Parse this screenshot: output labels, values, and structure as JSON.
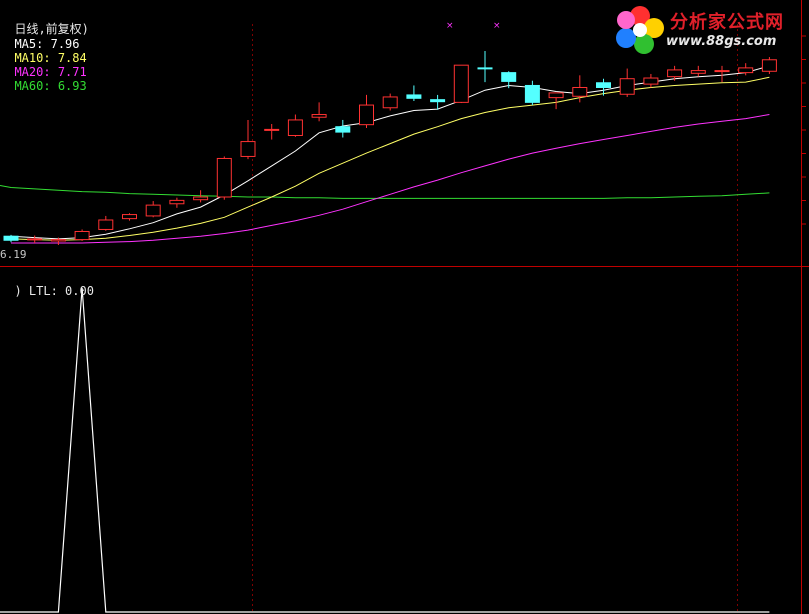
{
  "header": {
    "period": "日线,前复权)",
    "ma": [
      {
        "label": "MA5:",
        "value": "7.96",
        "color": "#ffffff"
      },
      {
        "label": "MA10:",
        "value": "7.84",
        "color": "#ffff66"
      },
      {
        "label": "MA20:",
        "value": "7.71",
        "color": "#ff33ff"
      },
      {
        "label": "MA60:",
        "value": "6.93",
        "color": "#33dd33"
      }
    ]
  },
  "low_label": "6.19",
  "indicator": {
    "label": ") LTL:",
    "value": "0.00"
  },
  "logo": {
    "name": "分析家公式网",
    "url": "www.88gs.com"
  },
  "colors": {
    "up": "#ff3232",
    "down": "#54ffff",
    "ma5": "#ffffff",
    "ma10": "#ffff66",
    "ma20": "#ff33ff",
    "ma60": "#33dd33",
    "divider": "#c00000",
    "ltl": "#ffffff"
  },
  "chart_data": [
    {
      "type": "candlestick",
      "title": "",
      "candles": [
        {
          "o": 6.32,
          "h": 6.34,
          "l": 6.23,
          "c": 6.26
        },
        {
          "o": 6.28,
          "h": 6.33,
          "l": 6.22,
          "c": 6.28
        },
        {
          "o": 6.25,
          "h": 6.3,
          "l": 6.19,
          "c": 6.27
        },
        {
          "o": 6.27,
          "h": 6.42,
          "l": 6.25,
          "c": 6.39
        },
        {
          "o": 6.42,
          "h": 6.62,
          "l": 6.4,
          "c": 6.56
        },
        {
          "o": 6.58,
          "h": 6.66,
          "l": 6.55,
          "c": 6.64
        },
        {
          "o": 6.62,
          "h": 6.84,
          "l": 6.6,
          "c": 6.78
        },
        {
          "o": 6.8,
          "h": 6.89,
          "l": 6.74,
          "c": 6.85
        },
        {
          "o": 6.86,
          "h": 7.0,
          "l": 6.82,
          "c": 6.9
        },
        {
          "o": 6.9,
          "h": 7.5,
          "l": 6.86,
          "c": 7.47
        },
        {
          "o": 7.5,
          "h": 8.04,
          "l": 7.46,
          "c": 7.72
        },
        {
          "o": 7.9,
          "h": 7.98,
          "l": 7.75,
          "c": 7.9
        },
        {
          "o": 7.81,
          "h": 8.12,
          "l": 7.79,
          "c": 8.04
        },
        {
          "o": 8.08,
          "h": 8.3,
          "l": 8.02,
          "c": 8.12
        },
        {
          "o": 7.94,
          "h": 8.04,
          "l": 7.78,
          "c": 7.86
        },
        {
          "o": 7.97,
          "h": 8.41,
          "l": 7.92,
          "c": 8.26
        },
        {
          "o": 8.22,
          "h": 8.43,
          "l": 8.18,
          "c": 8.38
        },
        {
          "o": 8.41,
          "h": 8.55,
          "l": 8.32,
          "c": 8.36
        },
        {
          "o": 8.34,
          "h": 8.41,
          "l": 8.19,
          "c": 8.31
        },
        {
          "o": 8.3,
          "h": 8.85,
          "l": 8.29,
          "c": 8.85
        },
        {
          "o": 8.81,
          "h": 9.06,
          "l": 8.6,
          "c": 8.8
        },
        {
          "o": 8.74,
          "h": 8.76,
          "l": 8.51,
          "c": 8.61
        },
        {
          "o": 8.55,
          "h": 8.62,
          "l": 8.26,
          "c": 8.3
        },
        {
          "o": 8.37,
          "h": 8.43,
          "l": 8.2,
          "c": 8.44
        },
        {
          "o": 8.39,
          "h": 8.7,
          "l": 8.3,
          "c": 8.52
        },
        {
          "o": 8.59,
          "h": 8.65,
          "l": 8.4,
          "c": 8.52
        },
        {
          "o": 8.42,
          "h": 8.8,
          "l": 8.38,
          "c": 8.65
        },
        {
          "o": 8.57,
          "h": 8.72,
          "l": 8.52,
          "c": 8.66
        },
        {
          "o": 8.68,
          "h": 8.84,
          "l": 8.62,
          "c": 8.78
        },
        {
          "o": 8.73,
          "h": 8.84,
          "l": 8.68,
          "c": 8.77
        },
        {
          "o": 8.77,
          "h": 8.84,
          "l": 8.6,
          "c": 8.77
        },
        {
          "o": 8.74,
          "h": 8.88,
          "l": 8.7,
          "c": 8.81
        },
        {
          "o": 8.76,
          "h": 8.97,
          "l": 8.72,
          "c": 8.93
        }
      ],
      "ma5": [
        6.32,
        6.3,
        6.28,
        6.3,
        6.35,
        6.43,
        6.52,
        6.65,
        6.75,
        6.93,
        7.14,
        7.36,
        7.58,
        7.85,
        7.95,
        8.0,
        8.1,
        8.18,
        8.2,
        8.33,
        8.48,
        8.55,
        8.52,
        8.46,
        8.43,
        8.48,
        8.55,
        8.6,
        8.65,
        8.68,
        8.7,
        8.74,
        8.84
      ],
      "ma10": [
        6.28,
        6.27,
        6.26,
        6.27,
        6.29,
        6.33,
        6.38,
        6.44,
        6.51,
        6.6,
        6.75,
        6.9,
        7.06,
        7.25,
        7.4,
        7.55,
        7.69,
        7.83,
        7.94,
        8.06,
        8.15,
        8.22,
        8.26,
        8.3,
        8.37,
        8.43,
        8.48,
        8.52,
        8.55,
        8.57,
        8.59,
        8.6,
        8.67
      ],
      "ma20": [
        6.22,
        6.22,
        6.22,
        6.22,
        6.23,
        6.24,
        6.26,
        6.29,
        6.32,
        6.36,
        6.41,
        6.48,
        6.55,
        6.63,
        6.72,
        6.83,
        6.94,
        7.05,
        7.15,
        7.26,
        7.36,
        7.46,
        7.55,
        7.62,
        7.69,
        7.75,
        7.81,
        7.87,
        7.93,
        7.98,
        8.02,
        8.06,
        8.12
      ],
      "ma60": [
        7.04,
        7.02,
        7.0,
        6.98,
        6.97,
        6.95,
        6.94,
        6.93,
        6.92,
        6.91,
        6.9,
        6.9,
        6.89,
        6.89,
        6.88,
        6.88,
        6.88,
        6.88,
        6.88,
        6.88,
        6.88,
        6.88,
        6.88,
        6.88,
        6.88,
        6.88,
        6.89,
        6.89,
        6.9,
        6.91,
        6.92,
        6.94,
        6.96
      ],
      "ylim": [
        6.19,
        9.4
      ]
    },
    {
      "type": "line",
      "title": "",
      "series": [
        {
          "values": [
            0,
            0,
            0,
            1,
            0,
            0,
            0,
            0,
            0,
            0,
            0,
            0,
            0,
            0,
            0,
            0,
            0,
            0,
            0,
            0,
            0,
            0,
            0,
            0,
            0,
            0,
            0,
            0,
            0,
            0,
            0,
            0,
            0
          ]
        }
      ],
      "ylim": [
        0,
        1
      ]
    }
  ]
}
